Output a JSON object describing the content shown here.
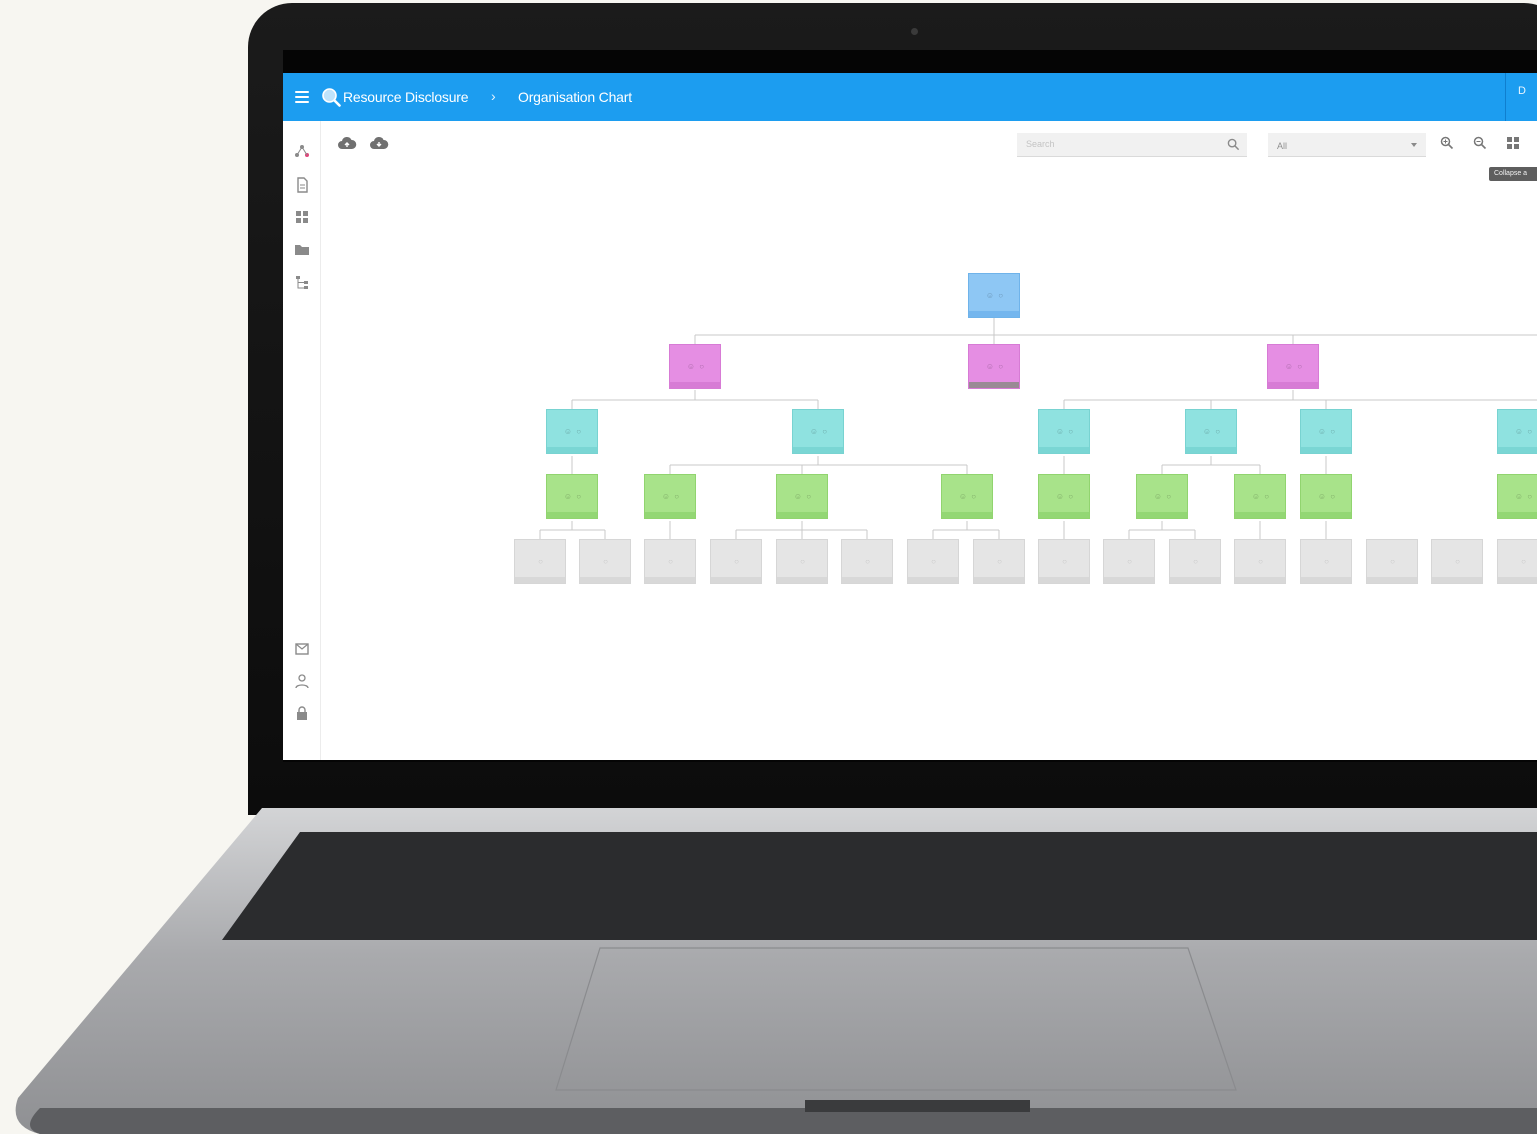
{
  "header": {
    "brand": "Resource Disclosure",
    "separator": "›",
    "page_title": "Organisation Chart",
    "edge_text": "D"
  },
  "toolbar": {
    "search_placeholder": "Search",
    "filter_value": "All",
    "tooltip": "Collapse a"
  },
  "colors": {
    "header": "#1c9df0",
    "level_0": "#8ec7f4",
    "level_1": "#e58ee3",
    "level_2": "#8fe2e0",
    "level_3": "#a8e38a",
    "level_4": "#e5e5e5"
  },
  "icons": {
    "sidebar_top": [
      "network-icon",
      "document-icon",
      "dashboard-icon",
      "folder-icon",
      "hierarchy-icon"
    ],
    "sidebar_bottom": [
      "mail-icon",
      "user-icon",
      "lock-icon"
    ],
    "toolbar": [
      "cloud-upload-icon",
      "cloud-download-icon",
      "search-icon",
      "zoom-in-icon",
      "zoom-out-icon",
      "fit-screen-icon"
    ]
  }
}
